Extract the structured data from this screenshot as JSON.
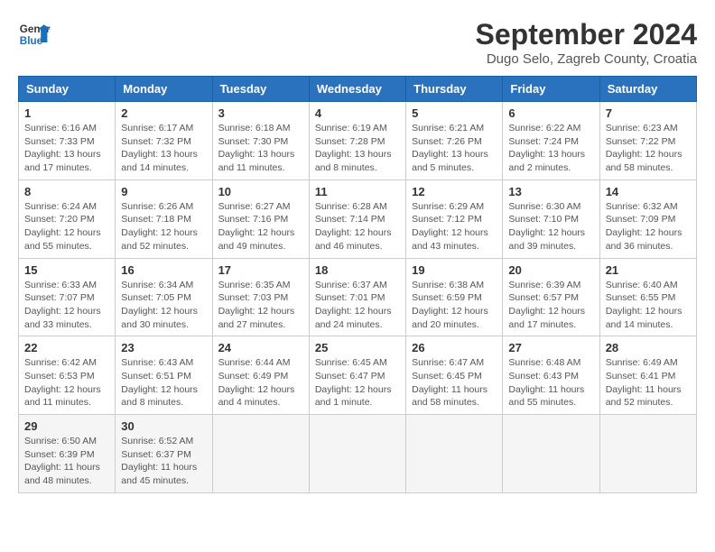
{
  "header": {
    "logo_line1": "General",
    "logo_line2": "Blue",
    "month": "September 2024",
    "location": "Dugo Selo, Zagreb County, Croatia"
  },
  "weekdays": [
    "Sunday",
    "Monday",
    "Tuesday",
    "Wednesday",
    "Thursday",
    "Friday",
    "Saturday"
  ],
  "weeks": [
    [
      {
        "day": 1,
        "sunrise": "6:16 AM",
        "sunset": "7:33 PM",
        "daylight": "13 hours and 17 minutes."
      },
      {
        "day": 2,
        "sunrise": "6:17 AM",
        "sunset": "7:32 PM",
        "daylight": "13 hours and 14 minutes."
      },
      {
        "day": 3,
        "sunrise": "6:18 AM",
        "sunset": "7:30 PM",
        "daylight": "13 hours and 11 minutes."
      },
      {
        "day": 4,
        "sunrise": "6:19 AM",
        "sunset": "7:28 PM",
        "daylight": "13 hours and 8 minutes."
      },
      {
        "day": 5,
        "sunrise": "6:21 AM",
        "sunset": "7:26 PM",
        "daylight": "13 hours and 5 minutes."
      },
      {
        "day": 6,
        "sunrise": "6:22 AM",
        "sunset": "7:24 PM",
        "daylight": "13 hours and 2 minutes."
      },
      {
        "day": 7,
        "sunrise": "6:23 AM",
        "sunset": "7:22 PM",
        "daylight": "12 hours and 58 minutes."
      }
    ],
    [
      {
        "day": 8,
        "sunrise": "6:24 AM",
        "sunset": "7:20 PM",
        "daylight": "12 hours and 55 minutes."
      },
      {
        "day": 9,
        "sunrise": "6:26 AM",
        "sunset": "7:18 PM",
        "daylight": "12 hours and 52 minutes."
      },
      {
        "day": 10,
        "sunrise": "6:27 AM",
        "sunset": "7:16 PM",
        "daylight": "12 hours and 49 minutes."
      },
      {
        "day": 11,
        "sunrise": "6:28 AM",
        "sunset": "7:14 PM",
        "daylight": "12 hours and 46 minutes."
      },
      {
        "day": 12,
        "sunrise": "6:29 AM",
        "sunset": "7:12 PM",
        "daylight": "12 hours and 43 minutes."
      },
      {
        "day": 13,
        "sunrise": "6:30 AM",
        "sunset": "7:10 PM",
        "daylight": "12 hours and 39 minutes."
      },
      {
        "day": 14,
        "sunrise": "6:32 AM",
        "sunset": "7:09 PM",
        "daylight": "12 hours and 36 minutes."
      }
    ],
    [
      {
        "day": 15,
        "sunrise": "6:33 AM",
        "sunset": "7:07 PM",
        "daylight": "12 hours and 33 minutes."
      },
      {
        "day": 16,
        "sunrise": "6:34 AM",
        "sunset": "7:05 PM",
        "daylight": "12 hours and 30 minutes."
      },
      {
        "day": 17,
        "sunrise": "6:35 AM",
        "sunset": "7:03 PM",
        "daylight": "12 hours and 27 minutes."
      },
      {
        "day": 18,
        "sunrise": "6:37 AM",
        "sunset": "7:01 PM",
        "daylight": "12 hours and 24 minutes."
      },
      {
        "day": 19,
        "sunrise": "6:38 AM",
        "sunset": "6:59 PM",
        "daylight": "12 hours and 20 minutes."
      },
      {
        "day": 20,
        "sunrise": "6:39 AM",
        "sunset": "6:57 PM",
        "daylight": "12 hours and 17 minutes."
      },
      {
        "day": 21,
        "sunrise": "6:40 AM",
        "sunset": "6:55 PM",
        "daylight": "12 hours and 14 minutes."
      }
    ],
    [
      {
        "day": 22,
        "sunrise": "6:42 AM",
        "sunset": "6:53 PM",
        "daylight": "12 hours and 11 minutes."
      },
      {
        "day": 23,
        "sunrise": "6:43 AM",
        "sunset": "6:51 PM",
        "daylight": "12 hours and 8 minutes."
      },
      {
        "day": 24,
        "sunrise": "6:44 AM",
        "sunset": "6:49 PM",
        "daylight": "12 hours and 4 minutes."
      },
      {
        "day": 25,
        "sunrise": "6:45 AM",
        "sunset": "6:47 PM",
        "daylight": "12 hours and 1 minute."
      },
      {
        "day": 26,
        "sunrise": "6:47 AM",
        "sunset": "6:45 PM",
        "daylight": "11 hours and 58 minutes."
      },
      {
        "day": 27,
        "sunrise": "6:48 AM",
        "sunset": "6:43 PM",
        "daylight": "11 hours and 55 minutes."
      },
      {
        "day": 28,
        "sunrise": "6:49 AM",
        "sunset": "6:41 PM",
        "daylight": "11 hours and 52 minutes."
      }
    ],
    [
      {
        "day": 29,
        "sunrise": "6:50 AM",
        "sunset": "6:39 PM",
        "daylight": "11 hours and 48 minutes."
      },
      {
        "day": 30,
        "sunrise": "6:52 AM",
        "sunset": "6:37 PM",
        "daylight": "11 hours and 45 minutes."
      },
      null,
      null,
      null,
      null,
      null
    ]
  ]
}
